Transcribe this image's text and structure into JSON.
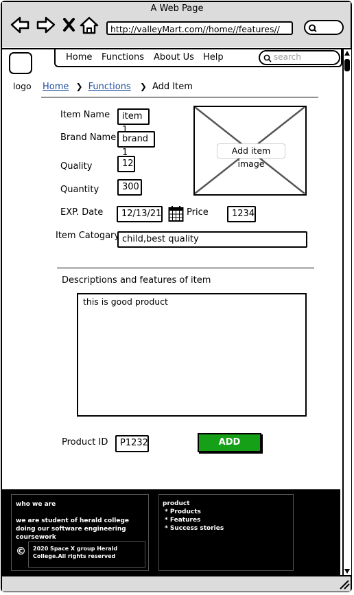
{
  "window": {
    "title": "A Web Page"
  },
  "address_bar": {
    "url": "http://valleyMart.com//home//features//"
  },
  "logo": {
    "label": "logo"
  },
  "menu": {
    "items": [
      "Home",
      "Functions",
      "About Us",
      "Help"
    ],
    "search_placeholder": "search"
  },
  "breadcrumb": {
    "home": "Home",
    "functions": "Functions",
    "current": "Add Item"
  },
  "form": {
    "item_name_label": "Item Name",
    "item_name_value": "item 1",
    "brand_name_label": "Brand Name",
    "brand_name_value": "brand 1",
    "quality_label": "Quality",
    "quality_value": "12",
    "quantity_label": "Quantity",
    "quantity_value": "300",
    "exp_date_label": "EXP. Date",
    "exp_date_value": "12/13/21",
    "price_label": "Price",
    "price_value": "1234",
    "category_label": "Item Catogary",
    "category_value": "child,best quality",
    "image_caption": "Add item image",
    "description_label": "Descriptions and features of item",
    "description_value": "this is good product",
    "product_id_label": "Product ID",
    "product_id_value": "P1232",
    "add_button": "ADD"
  },
  "footer": {
    "who_title": "who we are",
    "who_text": "we are student of herald college doing our software engineering coursework",
    "copyright_symbol": "©",
    "copyright_text": "2020 Space X group Herald College.All rights reserved",
    "product_title": "product",
    "product_links": [
      "* Products",
      "* Features",
      "* Success stories"
    ]
  },
  "colors": {
    "add_button": "#16a017",
    "breadcrumb_link": "#1f4fa0",
    "chrome": "#dcdcdc",
    "footer": "#000000"
  }
}
